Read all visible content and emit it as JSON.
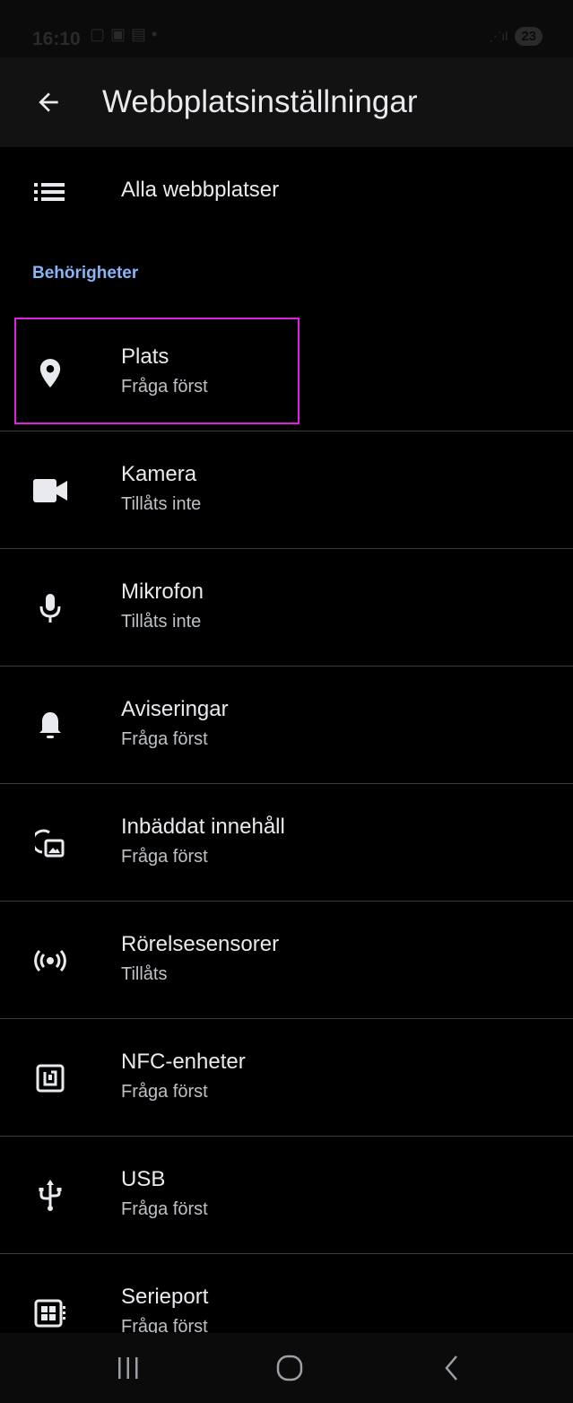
{
  "status": {
    "time": "16:10",
    "battery": "23"
  },
  "header": {
    "title": "Webbplatsinställningar"
  },
  "all_sites": {
    "label": "Alla webbplatser"
  },
  "section": {
    "label": "Behörigheter"
  },
  "permissions": [
    {
      "title": "Plats",
      "subtitle": "Fråga först",
      "icon": "location-pin-icon"
    },
    {
      "title": "Kamera",
      "subtitle": "Tillåts inte",
      "icon": "camera-icon"
    },
    {
      "title": "Mikrofon",
      "subtitle": "Tillåts inte",
      "icon": "microphone-icon"
    },
    {
      "title": "Aviseringar",
      "subtitle": "Fråga först",
      "icon": "bell-icon"
    },
    {
      "title": "Inbäddat innehåll",
      "subtitle": "Fråga först",
      "icon": "embedded-content-icon"
    },
    {
      "title": "Rörelsesensorer",
      "subtitle": "Tillåts",
      "icon": "sensors-icon"
    },
    {
      "title": "NFC-enheter",
      "subtitle": "Fråga först",
      "icon": "nfc-icon"
    },
    {
      "title": "USB",
      "subtitle": "Fråga först",
      "icon": "usb-icon"
    },
    {
      "title": "Serieport",
      "subtitle": "Fråga först",
      "icon": "serial-port-icon"
    }
  ],
  "colors": {
    "accent": "#8ab4f8",
    "highlight": "#e020e0",
    "background": "#000000"
  }
}
